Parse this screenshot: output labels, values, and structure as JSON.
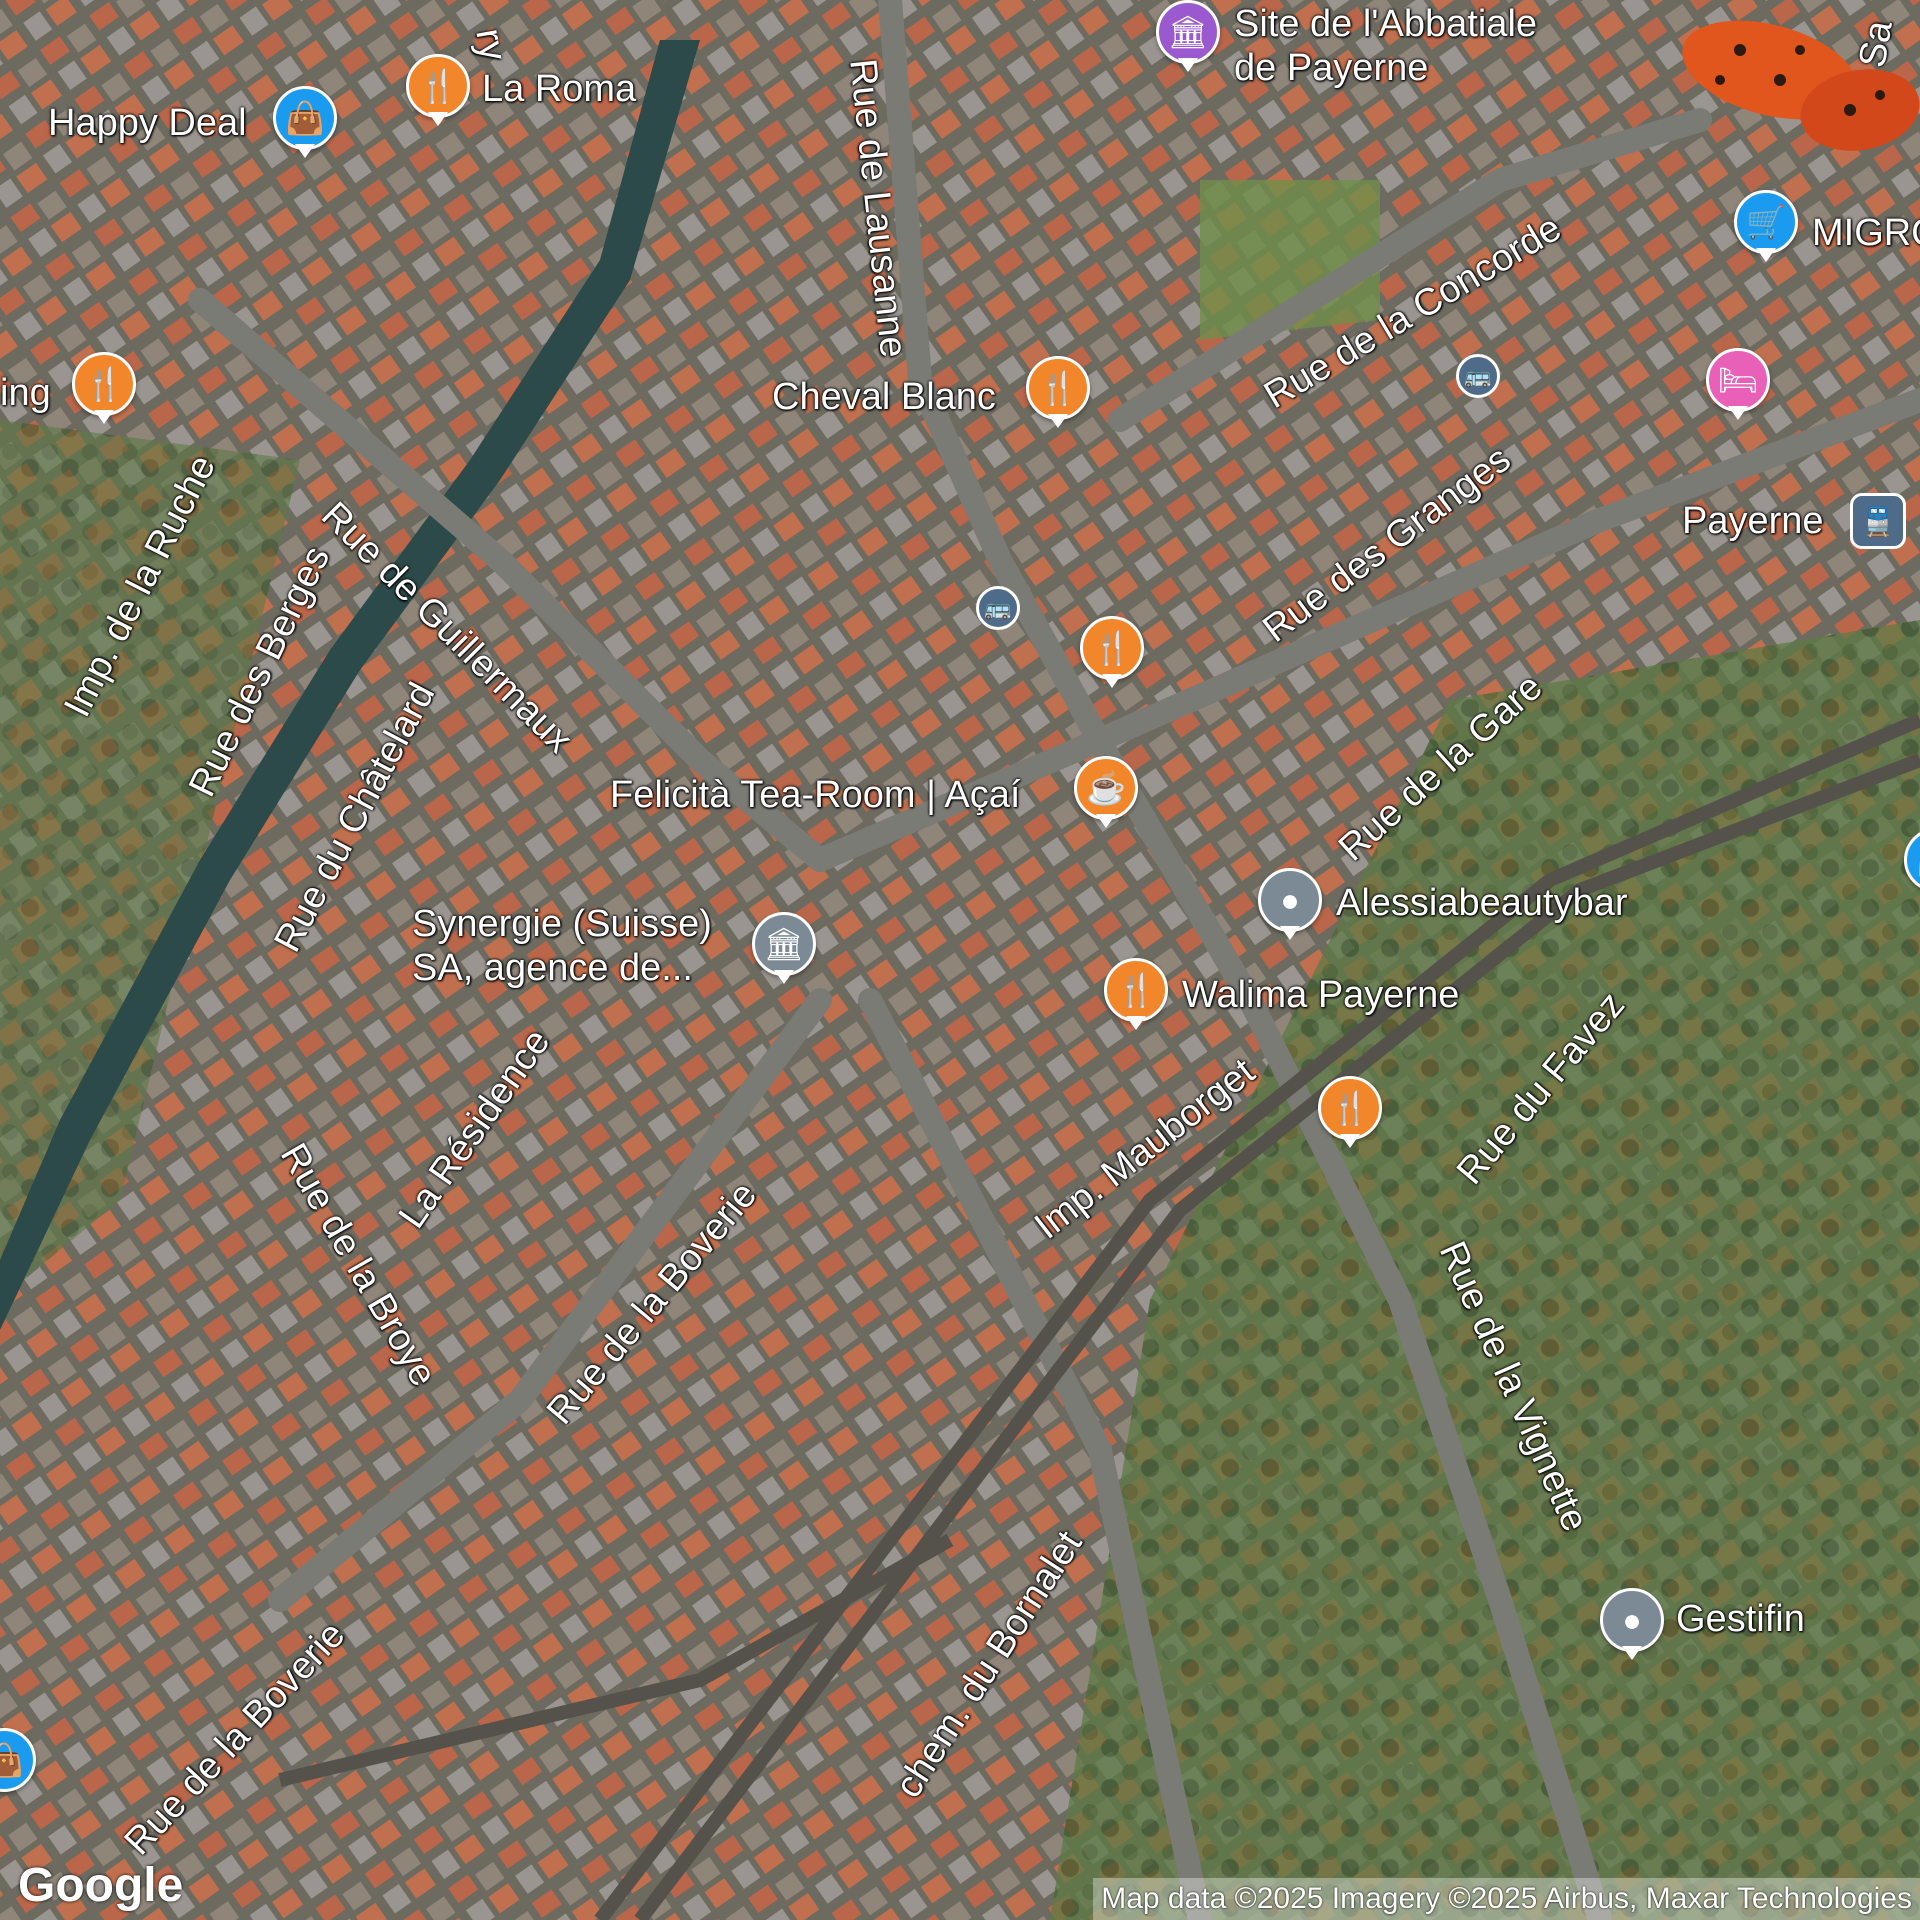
{
  "colors": {
    "food": "#f2862a",
    "shop": "#1a9bf0",
    "museum": "#9b59d0",
    "hotel": "#e860b8",
    "generic": "#7c8a96",
    "civic": "#7c8a96",
    "transit": "#4e6b8a"
  },
  "streets": [
    {
      "id": "rue-de-lausanne",
      "label": "Rue de Lausanne"
    },
    {
      "id": "rue-de-la-concorde",
      "label": "Rue de la Concorde"
    },
    {
      "id": "rue-des-granges",
      "label": "Rue des Granges"
    },
    {
      "id": "rue-de-la-gare",
      "label": "Rue de la Gare"
    },
    {
      "id": "rue-de-guillermaux",
      "label": "Rue de Guillermaux"
    },
    {
      "id": "imp-de-la-ruche",
      "label": "Imp. de la Ruche"
    },
    {
      "id": "rue-des-berges",
      "label": "Rue des Berges"
    },
    {
      "id": "rue-du-chatelard",
      "label": "Rue du Châtelard"
    },
    {
      "id": "la-residence",
      "label": "La Résidence"
    },
    {
      "id": "rue-de-la-broye",
      "label": "Rue de la Broye"
    },
    {
      "id": "rue-de-la-boverie",
      "label": "Rue de la Boverie"
    },
    {
      "id": "rue-de-la-boverie-2",
      "label": "Rue de la Boverie"
    },
    {
      "id": "imp-mauborget",
      "label": "Imp. Mauborget"
    },
    {
      "id": "rue-du-favez",
      "label": "Rue du Favez"
    },
    {
      "id": "rue-de-la-vignette",
      "label": "Rue de la Vignette"
    },
    {
      "id": "chem-du-bornalet",
      "label": "chem. du Bornalet"
    },
    {
      "id": "rue-sa-edge",
      "label": "Sa"
    },
    {
      "id": "ry-edge",
      "label": "ry"
    }
  ],
  "pois": [
    {
      "id": "site-abbatiale",
      "label": "Site de l'Abbatiale\nde Payerne",
      "category": "museum",
      "icon": "museum-icon"
    },
    {
      "id": "la-roma",
      "label": "La Roma",
      "category": "food",
      "icon": "fork-knife-icon"
    },
    {
      "id": "happy-deal",
      "label": "Happy Deal",
      "category": "shop",
      "icon": "shopping-bag-icon"
    },
    {
      "id": "ing",
      "label": "ing",
      "category": "food",
      "icon": "fork-knife-icon"
    },
    {
      "id": "cheval-blanc",
      "label": "Cheval Blanc",
      "category": "food",
      "icon": "fork-knife-icon"
    },
    {
      "id": "migros",
      "label": "MIGRO",
      "category": "shop",
      "icon": "shopping-cart-icon"
    },
    {
      "id": "hotel",
      "label": "",
      "category": "hotel",
      "icon": "bed-icon"
    },
    {
      "id": "restaurant-center",
      "label": "",
      "category": "food",
      "icon": "fork-knife-icon"
    },
    {
      "id": "felicita",
      "label": "Felicità Tea-Room | Açaí",
      "category": "food",
      "icon": "coffee-cup-icon"
    },
    {
      "id": "alessia",
      "label": "Alessiabeautybar",
      "category": "generic",
      "icon": "location-pin-icon"
    },
    {
      "id": "synergie",
      "label": "Synergie (Suisse)\nSA, agence de...",
      "category": "civic",
      "icon": "bank-icon"
    },
    {
      "id": "walima",
      "label": "Walima Payerne",
      "category": "food",
      "icon": "fork-knife-icon"
    },
    {
      "id": "restaurant-mauborget",
      "label": "",
      "category": "food",
      "icon": "fork-knife-icon"
    },
    {
      "id": "gestifin",
      "label": "Gestifin",
      "category": "generic",
      "icon": "location-pin-icon"
    }
  ],
  "transit": [
    {
      "id": "payerne-station",
      "label": "Payerne",
      "icon": "train-station-icon"
    },
    {
      "id": "bus-stop-1",
      "label": "",
      "icon": "bus-stop-icon"
    },
    {
      "id": "bus-stop-2",
      "label": "",
      "icon": "bus-stop-icon"
    }
  ],
  "branding": {
    "logo": "Google",
    "attribution": "Map data ©2025 Imagery ©2025 Airbus, Maxar Technologies"
  }
}
